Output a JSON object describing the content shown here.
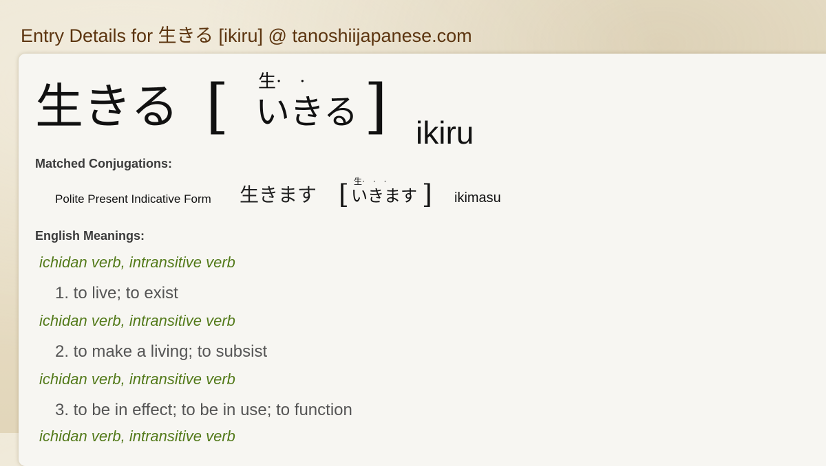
{
  "page": {
    "title": "Entry Details for 生きる [ikiru] @ tanoshiijapanese.com"
  },
  "headword": {
    "kanji": "生きる",
    "furigana_top": "生·　·",
    "reading": "いきる",
    "bracket_open": "[",
    "bracket_close": "]",
    "romaji": "ikiru"
  },
  "conjugations": {
    "label": "Matched Conjugations:",
    "items": [
      {
        "form": "Polite Present Indicative Form",
        "kanji": "生きます",
        "furigana_top": "生·　·　·",
        "reading": "いきます",
        "bracket_open": "[",
        "bracket_close": "]",
        "romaji": "ikimasu"
      }
    ]
  },
  "meanings": {
    "label": "English Meanings:",
    "items": [
      {
        "pos": "ichidan verb, intransitive verb",
        "text": "1. to live; to exist"
      },
      {
        "pos": "ichidan verb, intransitive verb",
        "text": "2. to make a living; to subsist"
      },
      {
        "pos": "ichidan verb, intransitive verb",
        "text": "3. to be in effect; to be in use; to function"
      },
      {
        "pos": "ichidan verb, intransitive verb",
        "text": ""
      }
    ]
  },
  "colors": {
    "title": "#5c3510",
    "pos": "#537a1a",
    "meaning": "#555555",
    "card": "#f7f6f2"
  }
}
